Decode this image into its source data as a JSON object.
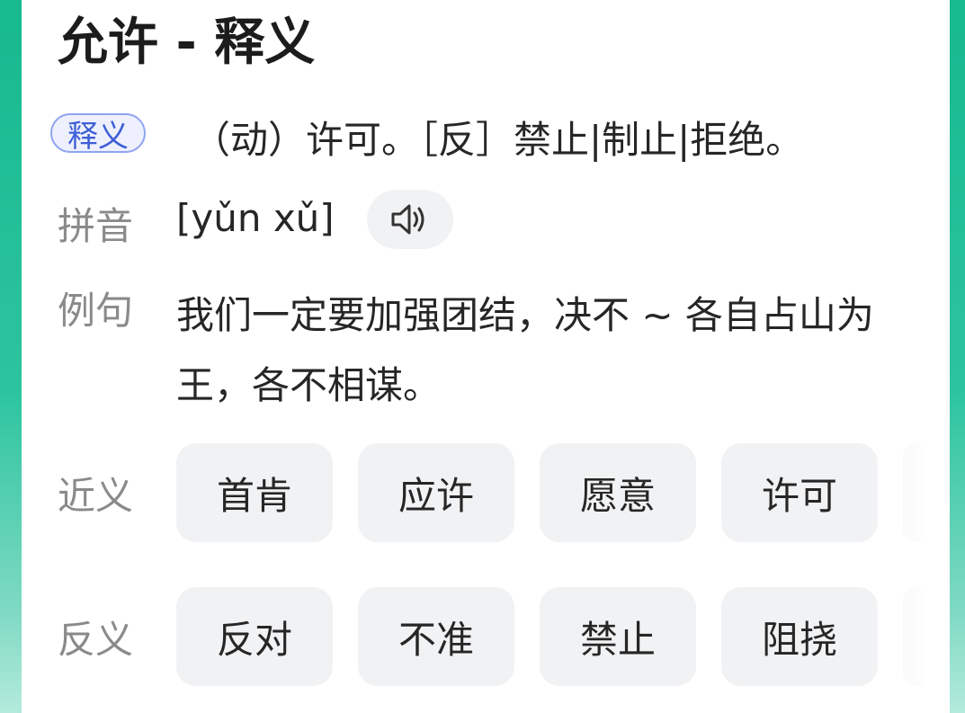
{
  "title": "允许 - 释义",
  "definition": {
    "badge": "释义",
    "text": "（动）许可。［反］禁止|制止|拒绝。"
  },
  "pinyin": {
    "label": "拼音",
    "value": "[yǔn xǔ]",
    "audio_icon": "speaker-icon"
  },
  "example": {
    "label": "例句",
    "text": "我们一定要加强团结，决不 ~ 各自占山为王，各不相谋。"
  },
  "synonyms": {
    "label": "近义",
    "items": [
      "首肯",
      "应许",
      "愿意",
      "许可"
    ]
  },
  "antonyms": {
    "label": "反义",
    "items": [
      "反对",
      "不准",
      "禁止",
      "阻挠"
    ]
  },
  "colors": {
    "background_accent": "#17b98f",
    "badge_border": "#8fa4f0",
    "badge_text": "#3e5fd6",
    "chip_bg": "#f1f2f4"
  }
}
